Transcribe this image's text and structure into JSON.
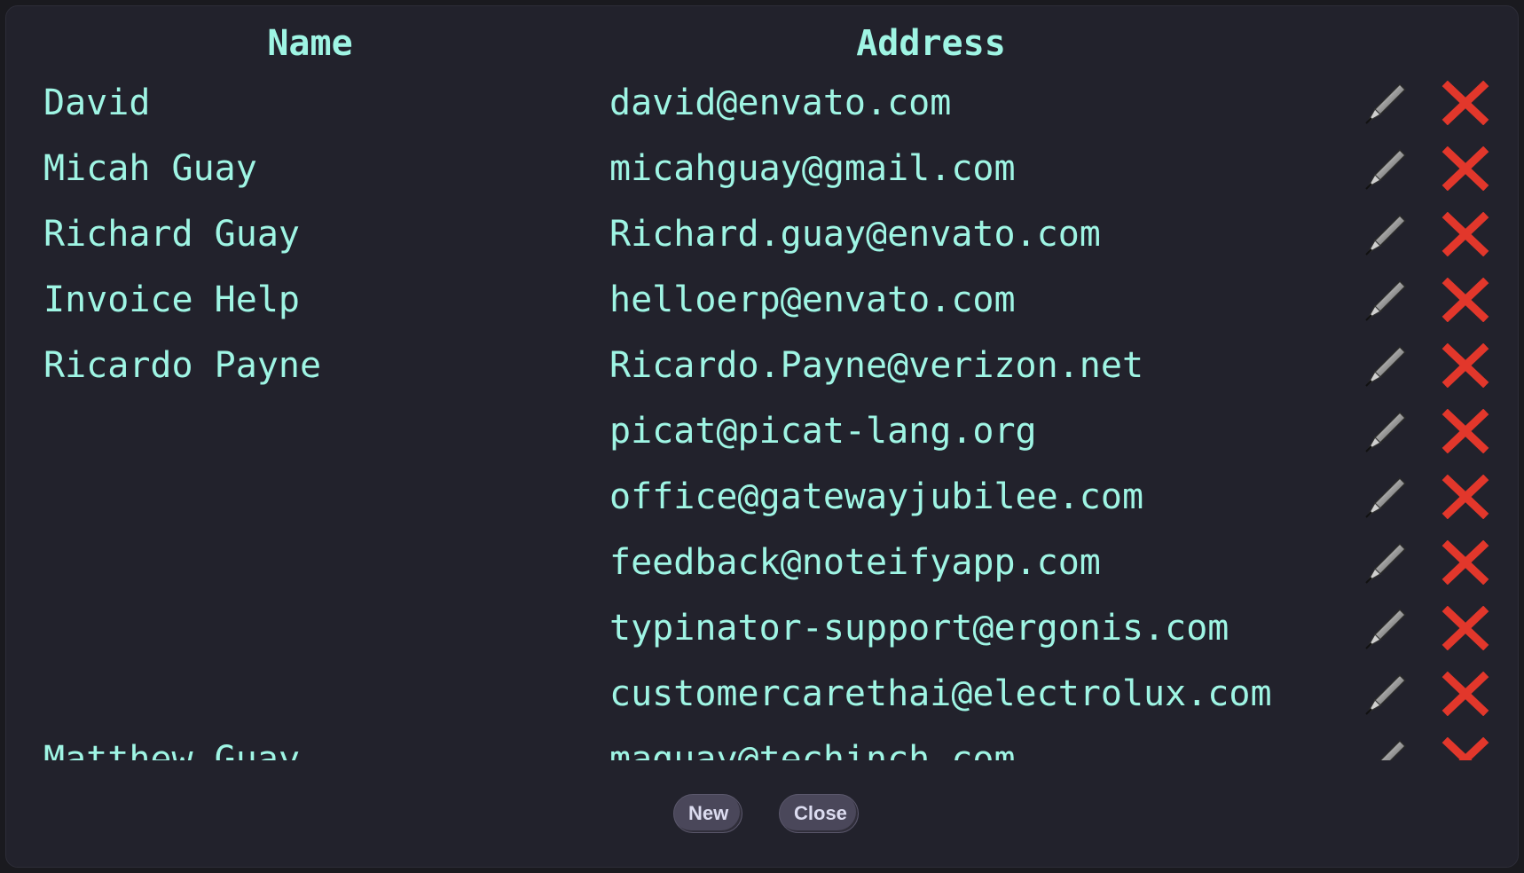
{
  "columns": {
    "name": "Name",
    "address": "Address"
  },
  "rows": [
    {
      "name": "David",
      "address": "david@envato.com"
    },
    {
      "name": "Micah Guay",
      "address": "micahguay@gmail.com"
    },
    {
      "name": "Richard Guay",
      "address": "Richard.guay@envato.com"
    },
    {
      "name": "Invoice Help",
      "address": "helloerp@envato.com"
    },
    {
      "name": "Ricardo Payne",
      "address": "Ricardo.Payne@verizon.net"
    },
    {
      "name": "",
      "address": "picat@picat-lang.org"
    },
    {
      "name": "",
      "address": "office@gatewayjubilee.com"
    },
    {
      "name": "",
      "address": "feedback@noteifyapp.com"
    },
    {
      "name": "",
      "address": "typinator-support@ergonis.com"
    },
    {
      "name": "",
      "address": "customercarethai@electrolux.com"
    },
    {
      "name": "Matthew Guay",
      "address": "maguay@techinch.com"
    }
  ],
  "row_icons": {
    "edit": "pen-icon",
    "delete": "close-x-icon"
  },
  "buttons": {
    "new_label": "New",
    "close_label": "Close"
  },
  "colors": {
    "background": "#22222c",
    "text": "#9ff5e4",
    "delete": "#e2372b",
    "button": "#4a475a"
  }
}
